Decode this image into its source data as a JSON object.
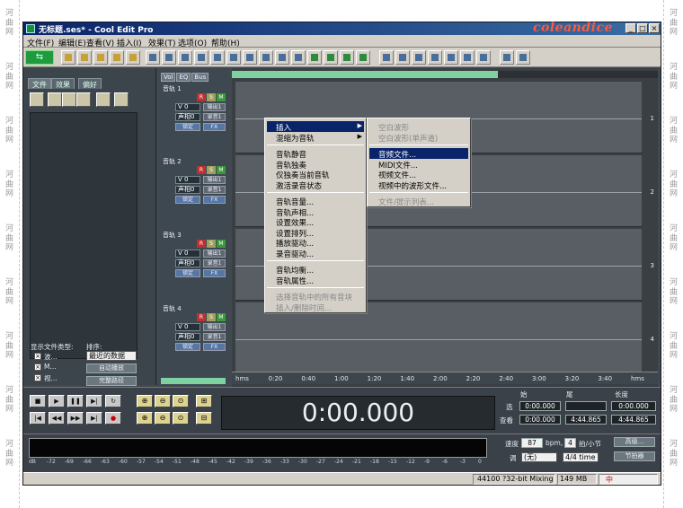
{
  "watermark": {
    "chars": [
      "河",
      "曲",
      "网"
    ]
  },
  "window": {
    "title": "无标题.ses* - Cool Edit Pro",
    "logo": "coleandice",
    "min": "_",
    "max": "□",
    "close": "×"
  },
  "menu": [
    "文件(F)",
    "编辑(E)",
    "查看(V)",
    "插入(I)",
    "效果(T)",
    "选项(O)",
    "帮助(H)"
  ],
  "organizer": {
    "tabs": [
      "文件",
      "效果",
      "偏好"
    ],
    "file_type_label": "显示文件类型:",
    "sort_label": "排序:",
    "type_wave": "波...",
    "type_midi": "M...",
    "type_video": "视...",
    "sort_value": "最近的数据",
    "auto_play": "自动播放",
    "full_path": "完整路径"
  },
  "track_header_tabs": [
    "Vol",
    "EQ",
    "Bus"
  ],
  "tracks": [
    {
      "name": "音轨 1",
      "vol": "V 0",
      "pan": "声相0",
      "out": "输出1",
      "rec": "录音1",
      "lock": "锁定",
      "fx": "FX"
    },
    {
      "name": "音轨 2",
      "vol": "V 0",
      "pan": "声相0",
      "out": "输出1",
      "rec": "录音1",
      "lock": "锁定",
      "fx": "FX"
    },
    {
      "name": "音轨 3",
      "vol": "V 0",
      "pan": "声相0",
      "out": "输出1",
      "rec": "录音1",
      "lock": "锁定",
      "fx": "FX"
    },
    {
      "name": "音轨 4",
      "vol": "V 0",
      "pan": "声相0",
      "out": "输出1",
      "rec": "录音1",
      "lock": "锁定",
      "fx": "FX"
    }
  ],
  "track_btn_letters": [
    "R",
    "S",
    "M"
  ],
  "lane_numbers": [
    "1",
    "2",
    "3",
    "4"
  ],
  "timeline": [
    "hms",
    "0:20",
    "0:40",
    "1:00",
    "1:20",
    "1:40",
    "2:00",
    "2:20",
    "2:40",
    "3:00",
    "3:20",
    "3:40",
    "hms"
  ],
  "context_menu": {
    "items": [
      {
        "label": "插入",
        "submenu": true,
        "highlight": true
      },
      {
        "label": "混缩为音轨",
        "submenu": true
      },
      {
        "sep": true
      },
      {
        "label": "音轨静音"
      },
      {
        "label": "音轨独奏"
      },
      {
        "label": "仅独奏当前音轨"
      },
      {
        "label": "激活录音状态"
      },
      {
        "sep": true
      },
      {
        "label": "音轨音量..."
      },
      {
        "label": "音轨声相..."
      },
      {
        "label": "设置效果..."
      },
      {
        "label": "设置排列..."
      },
      {
        "label": "播放驱动..."
      },
      {
        "label": "录音驱动..."
      },
      {
        "sep": true
      },
      {
        "label": "音轨均衡..."
      },
      {
        "label": "音轨属性..."
      },
      {
        "sep": true
      },
      {
        "label": "选择音轨中的所有音块",
        "disabled": true
      },
      {
        "label": "插入/删除时间...",
        "disabled": true
      }
    ]
  },
  "submenu": {
    "items": [
      {
        "label": "空白波形",
        "disabled": true
      },
      {
        "label": "空白波形(单声道)",
        "disabled": true
      },
      {
        "sep": true
      },
      {
        "label": "音频文件...",
        "highlight": true
      },
      {
        "label": "MIDI文件..."
      },
      {
        "label": "视频文件..."
      },
      {
        "label": "视频中的波形文件..."
      },
      {
        "sep": true
      },
      {
        "label": "文件/提示列表...",
        "disabled": true
      }
    ]
  },
  "transport": {
    "time": "0:00.000",
    "col_start": "始",
    "col_end": "尾",
    "col_length": "长度",
    "row_sel": "选",
    "row_view": "查看",
    "sel_start": "0:00.000",
    "sel_end": "",
    "sel_length": "0:00.000",
    "view_start": "0:00.000",
    "view_end": "4:44.865",
    "view_length": "4:44.865",
    "tempo_label": "速度",
    "tempo": "87",
    "bpm": "bpm,",
    "beats": "4",
    "beats_label": "拍/小节",
    "adv_button": "高级...",
    "key_label": "调",
    "key_value": "(无)",
    "sig": "4/4 time",
    "metronome": "节拍器"
  },
  "meter_scale": [
    "dB",
    "-72",
    "-69",
    "-66",
    "-63",
    "-60",
    "-57",
    "-54",
    "-51",
    "-48",
    "-45",
    "-42",
    "-39",
    "-36",
    "-33",
    "-30",
    "-27",
    "-24",
    "-21",
    "-18",
    "-15",
    "-12",
    "-9",
    "-6",
    "-3",
    "0"
  ],
  "status": {
    "format": "44100 ?32-bit Mixing",
    "free": "149 MB",
    "ime": "中"
  }
}
